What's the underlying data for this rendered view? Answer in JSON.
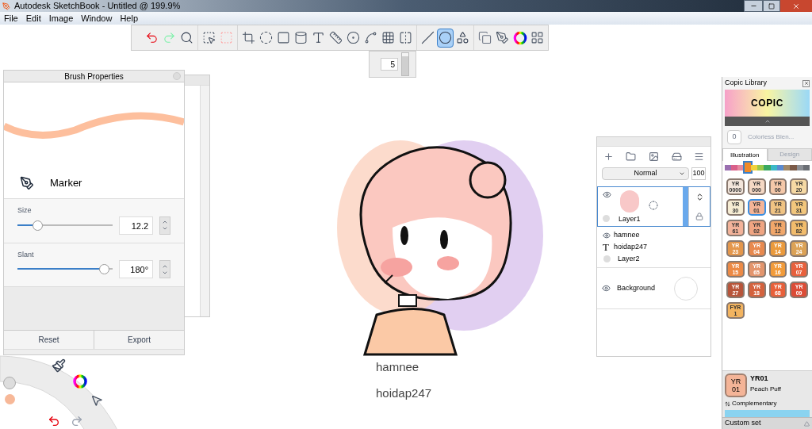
{
  "window": {
    "title": "Autodesk SketchBook - Untitled @ 199.9%"
  },
  "menu": [
    "File",
    "Edit",
    "Image",
    "Window",
    "Help"
  ],
  "toolbar": {
    "groups": [
      {
        "tools": [
          {
            "kind": "undo",
            "selected": false
          },
          {
            "kind": "redo",
            "selected": false
          },
          {
            "kind": "zoom",
            "selected": false
          }
        ]
      },
      {
        "tools": [
          {
            "kind": "select",
            "selected": false
          },
          {
            "kind": "deselect",
            "selected": false
          }
        ]
      },
      {
        "tools": [
          {
            "kind": "crop",
            "selected": false
          },
          {
            "kind": "lasso",
            "selected": false
          },
          {
            "kind": "transform",
            "selected": false
          },
          {
            "kind": "fill",
            "selected": false
          },
          {
            "kind": "text",
            "selected": false
          },
          {
            "kind": "ruler",
            "selected": false
          },
          {
            "kind": "ellipse-guide",
            "selected": false
          },
          {
            "kind": "curve",
            "selected": false
          },
          {
            "kind": "perspective",
            "selected": false
          },
          {
            "kind": "symmetry",
            "selected": false
          }
        ]
      },
      {
        "tools": [
          {
            "kind": "stroke",
            "selected": false
          },
          {
            "kind": "ellipse",
            "selected": true
          },
          {
            "kind": "shapes",
            "selected": false
          }
        ]
      },
      {
        "tools": [
          {
            "kind": "copy",
            "selected": false
          },
          {
            "kind": "brushes",
            "selected": false
          },
          {
            "kind": "color",
            "selected": false
          },
          {
            "kind": "panels",
            "selected": false
          }
        ]
      }
    ]
  },
  "brush_size_popup": {
    "value": "5",
    "level": 0.85
  },
  "brush_properties": {
    "title": "Brush Properties",
    "brush_name": "Marker",
    "sliders": [
      {
        "label": "Size",
        "value": "12.2",
        "level": 0.18
      },
      {
        "label": "Slant",
        "value": "180°",
        "level": 0.96
      }
    ],
    "buttons": [
      "Reset",
      "Export"
    ]
  },
  "canvas": {
    "texts": [
      "hamnee",
      "hoidap247"
    ]
  },
  "layers": {
    "blend_mode": "Normal",
    "opacity": "100",
    "layer": {
      "name": "Layer1",
      "selected": true,
      "visible": true
    },
    "sublayers": [
      {
        "kind": "visible",
        "name": "hamnee"
      },
      {
        "kind": "text",
        "icon": "T",
        "name": "hoidap247"
      },
      {
        "kind": "hidden",
        "name": "Layer2"
      }
    ],
    "background": {
      "name": "Background",
      "visible": true
    }
  },
  "copic": {
    "title": "Copic Library",
    "logo": "COPIC",
    "blender": {
      "code": "0",
      "name": "Colorless Blen..."
    },
    "tabs": [
      {
        "label": "Illustration",
        "selected": true
      },
      {
        "label": "Design",
        "selected": false
      }
    ],
    "families": [
      {
        "color": "#9a6fb0",
        "selected": false
      },
      {
        "color": "#d9608a",
        "selected": false
      },
      {
        "color": "#e78aa0",
        "selected": false
      },
      {
        "color": "#f08a2a",
        "selected": true
      },
      {
        "color": "#f2d23c",
        "selected": false
      },
      {
        "color": "#9cc84a",
        "selected": false
      },
      {
        "color": "#3aa860",
        "selected": false
      },
      {
        "color": "#3ab8c8",
        "selected": false
      },
      {
        "color": "#5a8ad0",
        "selected": false
      },
      {
        "color": "#a08868",
        "selected": false
      },
      {
        "color": "#7a5a48",
        "selected": false
      },
      {
        "color": "#8a8e94",
        "selected": false
      },
      {
        "color": "#6a6e74",
        "selected": false
      }
    ],
    "swatches": [
      {
        "family": "YR",
        "code": "0000",
        "color": "#f3e6dc",
        "selected": false
      },
      {
        "family": "YR",
        "code": "000",
        "color": "#f5d8c4",
        "selected": false
      },
      {
        "family": "YR",
        "code": "00",
        "color": "#f5c8a9",
        "selected": false
      },
      {
        "family": "YR",
        "code": "20",
        "color": "#f6d9a4",
        "selected": false
      },
      {
        "family": "YR",
        "code": "30",
        "color": "#f6ecd3",
        "selected": false
      },
      {
        "family": "YR",
        "code": "01",
        "color": "#f4b497",
        "selected": true
      },
      {
        "family": "YR",
        "code": "21",
        "color": "#f0c383",
        "selected": false
      },
      {
        "family": "YR",
        "code": "31",
        "color": "#f2c67c",
        "selected": false
      },
      {
        "family": "YR",
        "code": "61",
        "color": "#f3b39a",
        "selected": false
      },
      {
        "family": "YR",
        "code": "02",
        "color": "#f0a582",
        "selected": false
      },
      {
        "family": "YR",
        "code": "12",
        "color": "#f1a76a",
        "selected": false
      },
      {
        "family": "YR",
        "code": "82",
        "color": "#f2bc6c",
        "selected": false
      },
      {
        "family": "YR",
        "code": "23",
        "color": "#e4974c",
        "selected": false
      },
      {
        "family": "YR",
        "code": "04",
        "color": "#e8894e",
        "selected": false
      },
      {
        "family": "YR",
        "code": "14",
        "color": "#eb9a3c",
        "selected": false
      },
      {
        "family": "YR",
        "code": "24",
        "color": "#dca256",
        "selected": false
      },
      {
        "family": "YR",
        "code": "15",
        "color": "#ec8a46",
        "selected": false
      },
      {
        "family": "YR",
        "code": "65",
        "color": "#e3956d",
        "selected": false
      },
      {
        "family": "YR",
        "code": "16",
        "color": "#f29b3a",
        "selected": false
      },
      {
        "family": "YR",
        "code": "07",
        "color": "#e8603c",
        "selected": false
      },
      {
        "family": "YR",
        "code": "27",
        "color": "#b8553a",
        "selected": false
      },
      {
        "family": "YR",
        "code": "18",
        "color": "#d4623d",
        "selected": false
      },
      {
        "family": "YR",
        "code": "68",
        "color": "#e8603a",
        "selected": false
      },
      {
        "family": "YR",
        "code": "09",
        "color": "#dc4c36",
        "selected": false
      },
      {
        "family": "FYR",
        "code": "1",
        "color": "#f3b460",
        "selected": false
      }
    ],
    "current": {
      "family": "YR",
      "code": "01",
      "id": "YR01",
      "name": "Peach Puff",
      "color": "#f4b497"
    },
    "complementary": "Complementary",
    "custom_set": "Custom set"
  }
}
